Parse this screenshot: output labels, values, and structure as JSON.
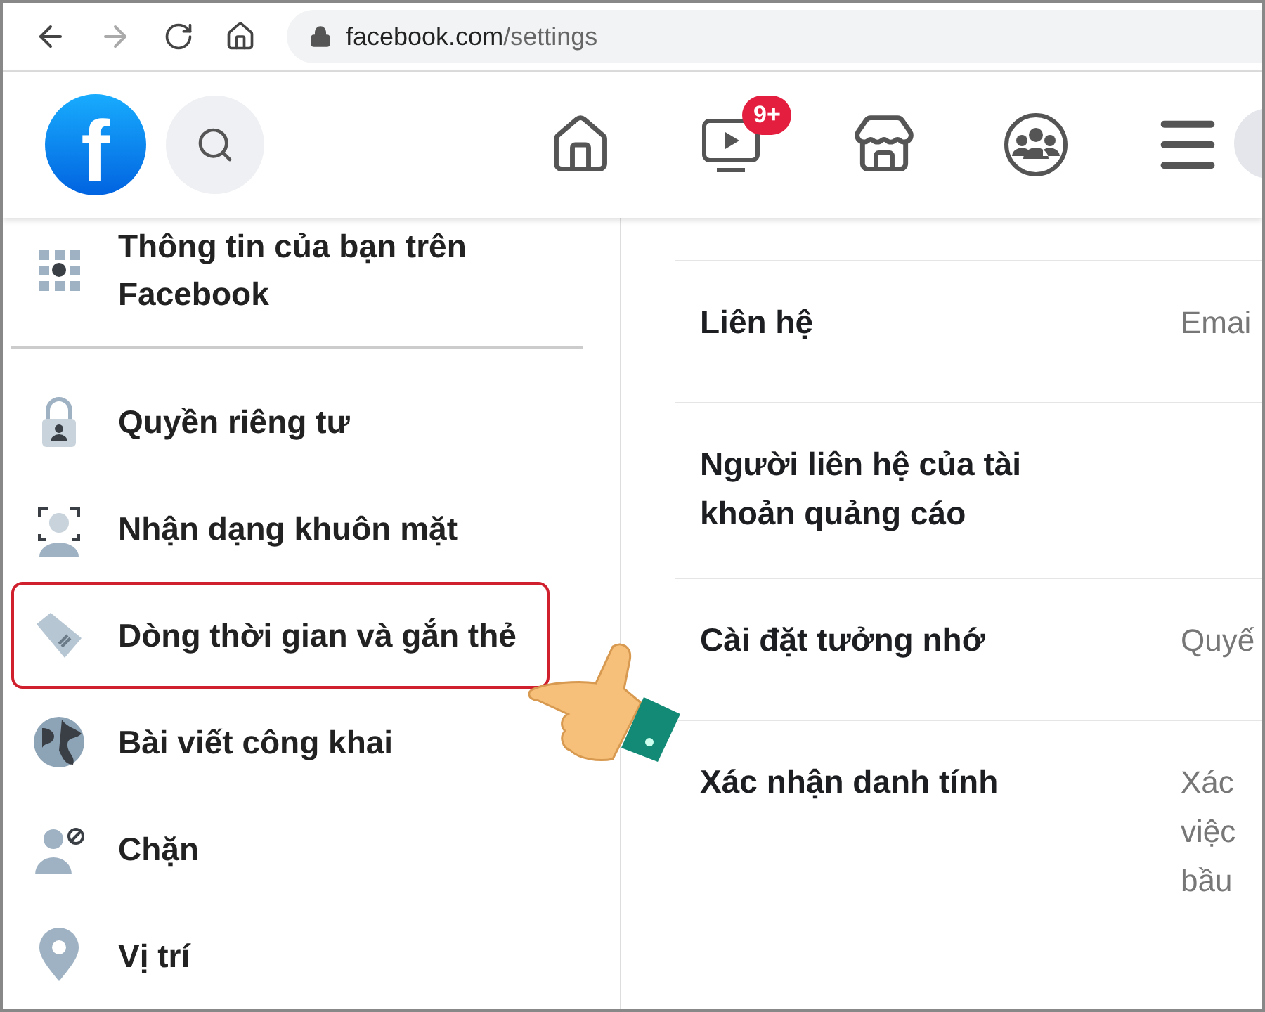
{
  "browser": {
    "url_host": "facebook.com",
    "url_path": "/settings"
  },
  "header": {
    "logo_letter": "f",
    "nav": [
      {
        "kind": "home"
      },
      {
        "kind": "watch",
        "badge": "9+"
      },
      {
        "kind": "marketplace"
      },
      {
        "kind": "groups"
      },
      {
        "kind": "menu"
      }
    ]
  },
  "sidebar": {
    "items": [
      {
        "kind": "grid",
        "label": "Thông tin của bạn trên Facebook",
        "selected": false
      },
      {
        "kind": "lock",
        "label": "Quyền riêng tư",
        "selected": false
      },
      {
        "kind": "face",
        "label": "Nhận dạng khuôn mặt",
        "selected": false
      },
      {
        "kind": "tag",
        "label": "Dòng thời gian và gắn thẻ",
        "selected": true
      },
      {
        "kind": "globe",
        "label": "Bài viết công khai",
        "selected": false
      },
      {
        "kind": "block",
        "label": "Chặn",
        "selected": false
      },
      {
        "kind": "pin",
        "label": "Vị trí",
        "selected": false
      }
    ]
  },
  "settings": [
    {
      "label": "Liên hệ",
      "value": [
        "Emai"
      ]
    },
    {
      "label": "Người liên hệ của tài khoản quảng cáo"
    },
    {
      "label": "Cài đặt tưởng nhớ",
      "value": [
        "Quyế"
      ]
    },
    {
      "label": "Xác nhận danh tính",
      "value": [
        "Xác",
        "việc",
        "bầu"
      ]
    }
  ]
}
